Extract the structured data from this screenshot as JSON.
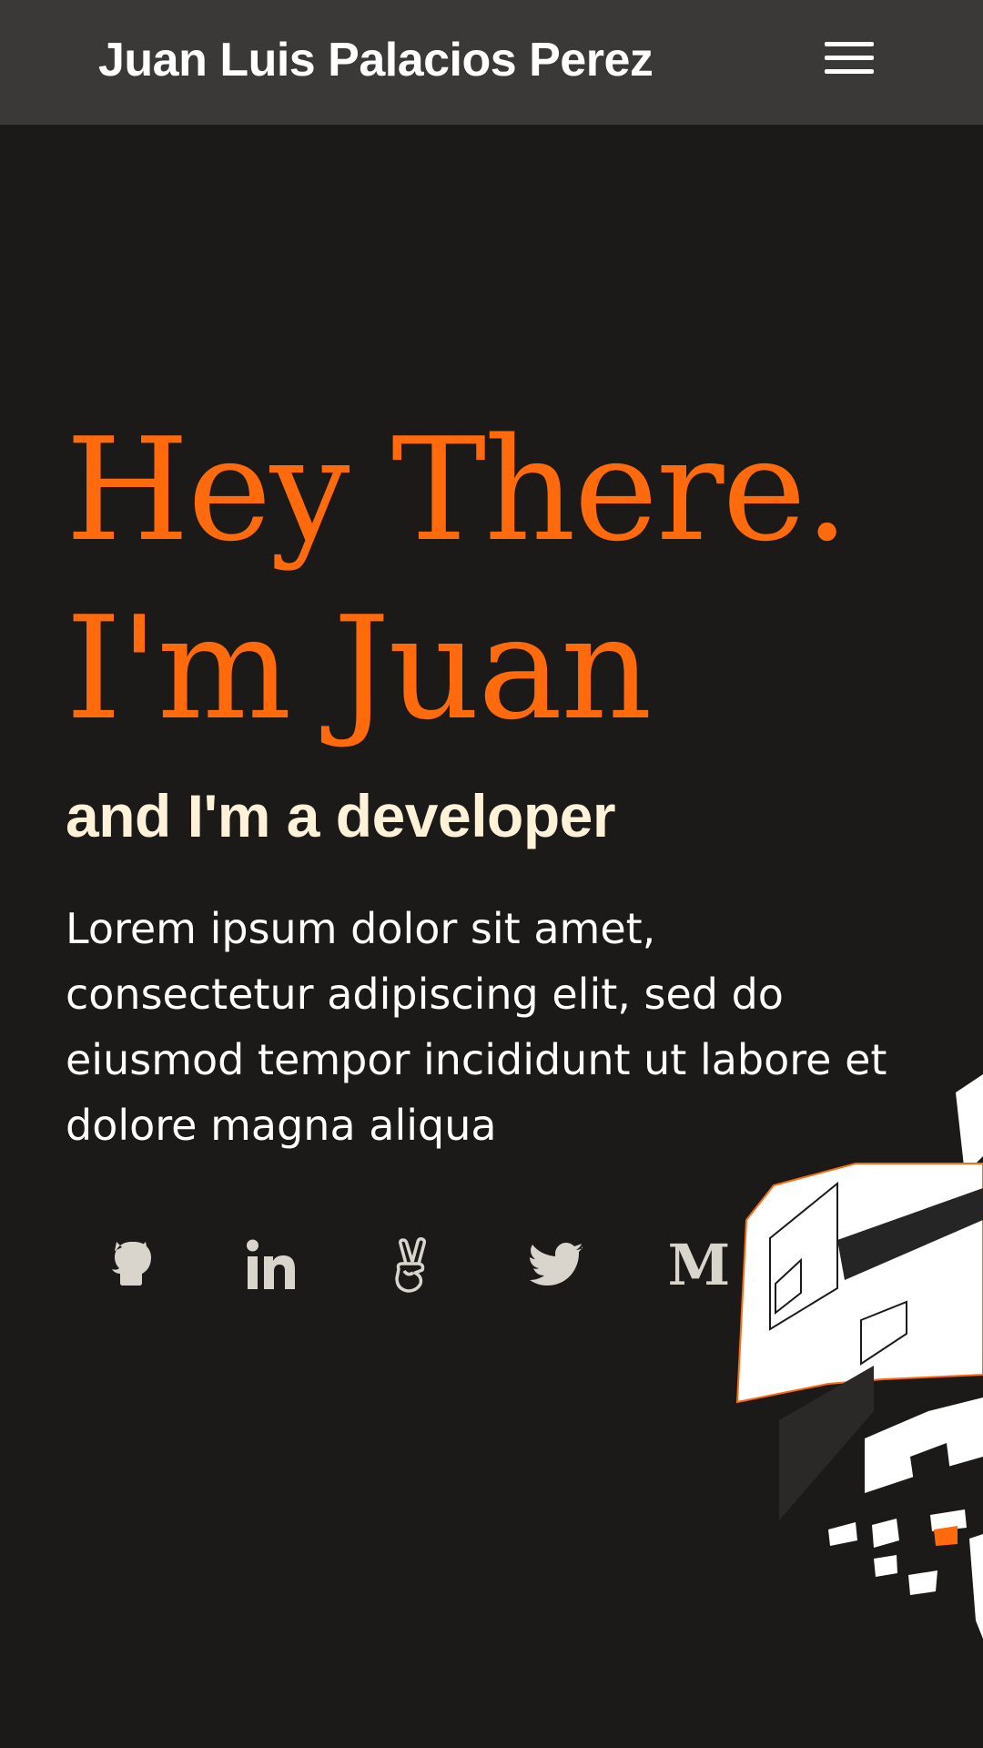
{
  "header": {
    "title": "Juan Luis Palacios Perez",
    "menu_icon": "hamburger-menu-icon"
  },
  "hero": {
    "heading_line1": "Hey There.",
    "heading_line2": "I'm Juan",
    "subheading": "and I'm a developer",
    "intro": "Lorem ipsum dolor sit amet, consectetur adipiscing elit, sed do eiusmod tempor incididunt ut labore et dolore magna aliqua"
  },
  "social": [
    {
      "icon": "github-icon"
    },
    {
      "icon": "linkedin-icon"
    },
    {
      "icon": "angellist-icon"
    },
    {
      "icon": "twitter-icon"
    },
    {
      "icon": "medium-icon",
      "glyph": "M"
    }
  ],
  "colors": {
    "background": "#1b1a19",
    "topbar": "#3a3938",
    "accent": "#ff6a0d",
    "subheading": "#fff2d8",
    "icon": "#d9d4cc"
  }
}
